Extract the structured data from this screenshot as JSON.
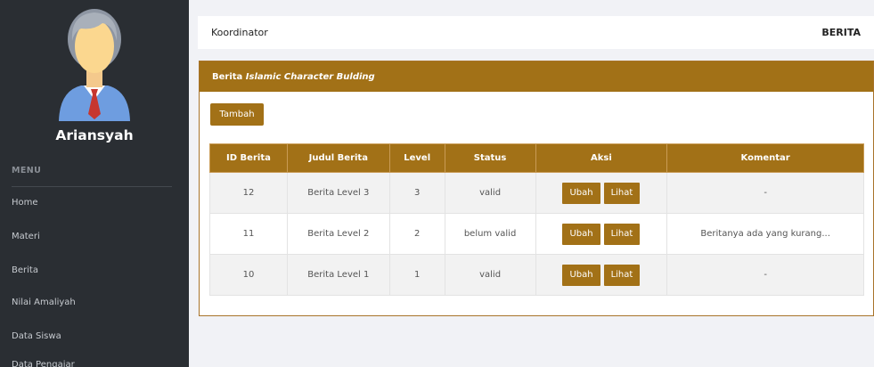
{
  "sidebar": {
    "user_name": "Ariansyah",
    "menu_title": "MENU",
    "items": [
      "Home",
      "Materi",
      "Berita",
      "Nilai Amaliyah",
      "Data Siswa",
      "Data Pengajar"
    ]
  },
  "topbar": {
    "left": "Koordinator",
    "right": "BERITA"
  },
  "panel": {
    "title_plain": "Berita ",
    "title_italic": "Islamic Character Bulding",
    "add_button": "Tambah"
  },
  "table": {
    "headers": [
      "ID Berita",
      "Judul Berita",
      "Level",
      "Status",
      "Aksi",
      "Komentar"
    ],
    "rows": [
      {
        "id": "12",
        "judul": "Berita Level 3",
        "level": "3",
        "status": "valid",
        "edit": "Ubah",
        "view": "Lihat",
        "komentar": "-"
      },
      {
        "id": "11",
        "judul": "Berita Level 2",
        "level": "2",
        "status": "belum valid",
        "edit": "Ubah",
        "view": "Lihat",
        "komentar": "Beritanya ada yang kurang..."
      },
      {
        "id": "10",
        "judul": "Berita Level 1",
        "level": "1",
        "status": "valid",
        "edit": "Ubah",
        "view": "Lihat",
        "komentar": "-"
      }
    ]
  },
  "colors": {
    "sidebar_bg": "#2a2e33",
    "accent": "#a27117",
    "page_bg": "#f1f2f6"
  },
  "icons": {
    "avatar": "user-avatar-icon"
  }
}
